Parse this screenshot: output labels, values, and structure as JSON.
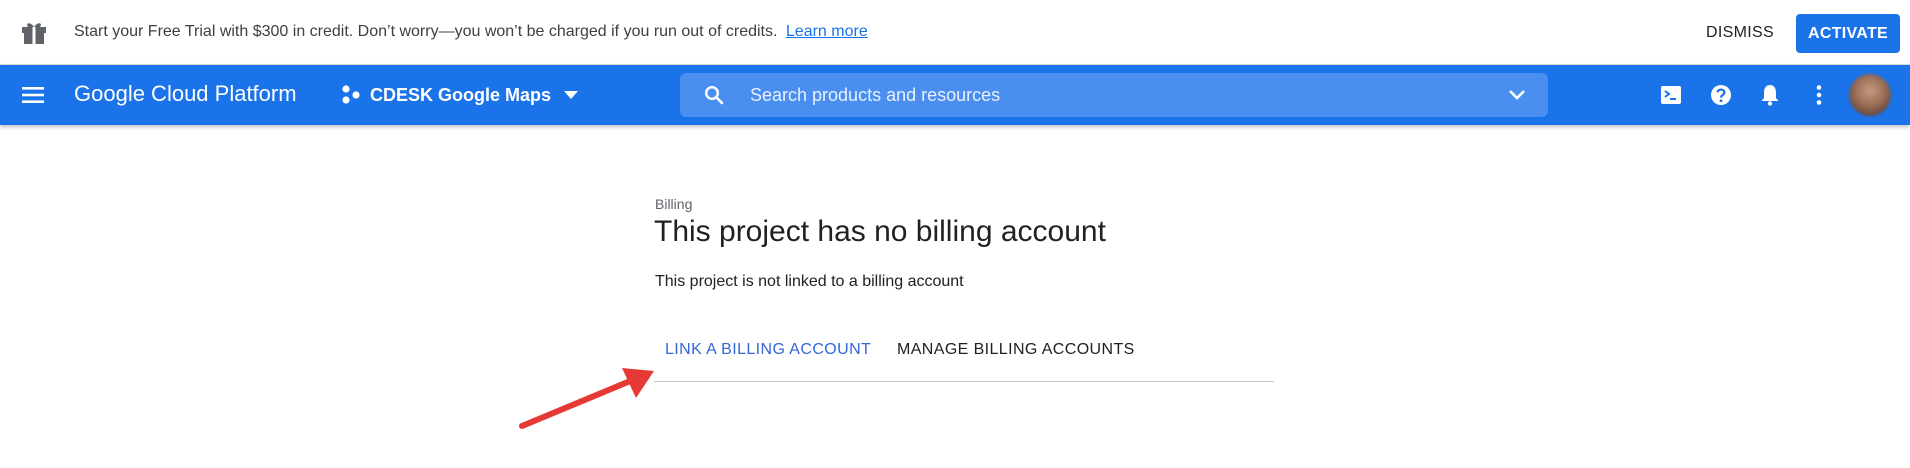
{
  "banner": {
    "message": "Start your Free Trial with $300 in credit. Don’t worry—you won’t be charged if you run out of credits.",
    "learn_more": "Learn more",
    "dismiss": "DISMISS",
    "activate": "ACTIVATE"
  },
  "topbar": {
    "title": "Google Cloud Platform",
    "project_name": "CDESK Google Maps",
    "search_placeholder": "Search products and resources",
    "icons": [
      "menu-icon",
      "project-dots-icon",
      "caret-down-icon",
      "search-icon",
      "chevron-down-icon",
      "cloud-shell-icon",
      "help-icon",
      "notifications-icon",
      "more-vert-icon"
    ]
  },
  "content": {
    "breadcrumb": "Billing",
    "title": "This project has no billing account",
    "description": "This project is not linked to a billing account",
    "tabs": [
      {
        "label": "LINK A BILLING ACCOUNT"
      },
      {
        "label": "MANAGE BILLING ACCOUNTS"
      }
    ]
  },
  "colors": {
    "brand_blue": "#1a73e8",
    "link_tab": "#3367d6",
    "annotation_arrow": "#e53935"
  }
}
